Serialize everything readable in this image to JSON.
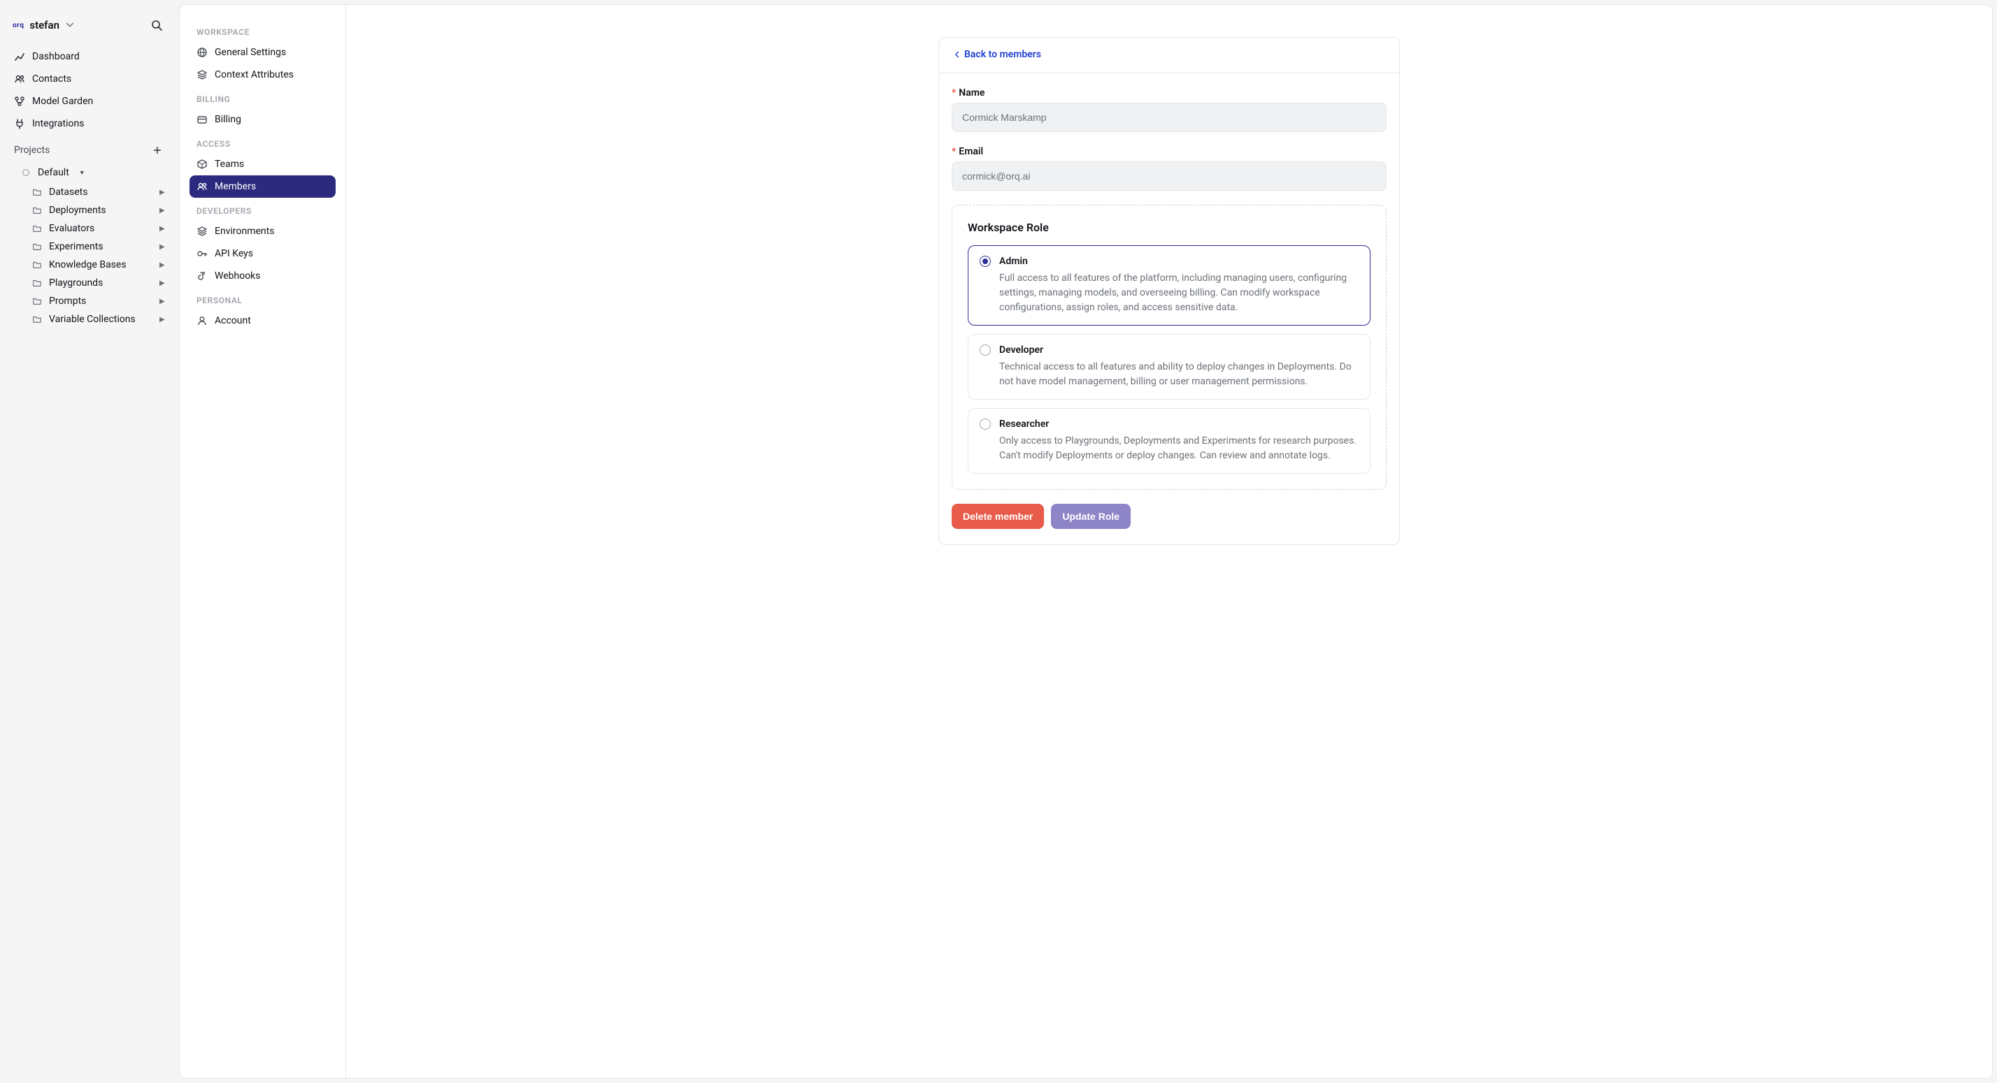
{
  "workspace": {
    "logoText": "orq",
    "name": "stefan"
  },
  "nav": {
    "primary": [
      {
        "id": "dashboard",
        "label": "Dashboard"
      },
      {
        "id": "contacts",
        "label": "Contacts"
      },
      {
        "id": "model-garden",
        "label": "Model Garden"
      },
      {
        "id": "integrations",
        "label": "Integrations"
      }
    ],
    "projectsTitle": "Projects",
    "project": {
      "name": "Default",
      "children": [
        {
          "id": "datasets",
          "label": "Datasets"
        },
        {
          "id": "deployments",
          "label": "Deployments"
        },
        {
          "id": "evaluators",
          "label": "Evaluators"
        },
        {
          "id": "experiments",
          "label": "Experiments"
        },
        {
          "id": "knowledge-bases",
          "label": "Knowledge Bases"
        },
        {
          "id": "playgrounds",
          "label": "Playgrounds"
        },
        {
          "id": "prompts",
          "label": "Prompts"
        },
        {
          "id": "variable-collections",
          "label": "Variable Collections"
        }
      ]
    }
  },
  "settings": {
    "groups": [
      {
        "title": "WORKSPACE",
        "items": [
          {
            "id": "general-settings",
            "label": "General Settings"
          },
          {
            "id": "context-attributes",
            "label": "Context Attributes"
          }
        ]
      },
      {
        "title": "BILLING",
        "items": [
          {
            "id": "billing",
            "label": "Billing"
          }
        ]
      },
      {
        "title": "ACCESS",
        "items": [
          {
            "id": "teams",
            "label": "Teams"
          },
          {
            "id": "members",
            "label": "Members",
            "active": true
          }
        ]
      },
      {
        "title": "DEVELOPERS",
        "items": [
          {
            "id": "environments",
            "label": "Environments"
          },
          {
            "id": "api-keys",
            "label": "API Keys"
          },
          {
            "id": "webhooks",
            "label": "Webhooks"
          }
        ]
      },
      {
        "title": "PERSONAL",
        "items": [
          {
            "id": "account",
            "label": "Account"
          }
        ]
      }
    ]
  },
  "member": {
    "backLabel": "Back to members",
    "nameLabel": "Name",
    "nameValue": "Cormick Marskamp",
    "emailLabel": "Email",
    "emailValue": "cormick@orq.ai",
    "roleTitle": "Workspace Role",
    "roles": [
      {
        "id": "admin",
        "name": "Admin",
        "selected": true,
        "desc": "Full access to all features of the platform, including managing users, configuring settings, managing models, and overseeing billing. Can modify workspace configurations, assign roles, and access sensitive data."
      },
      {
        "id": "developer",
        "name": "Developer",
        "selected": false,
        "desc": "Technical access to all features and ability to deploy changes in Deployments. Do not have model management, billing or user management permissions."
      },
      {
        "id": "researcher",
        "name": "Researcher",
        "selected": false,
        "desc": "Only access to Playgrounds, Deployments and Experiments for research purposes. Can't modify Deployments or deploy changes. Can review and annotate logs."
      }
    ],
    "deleteLabel": "Delete member",
    "updateLabel": "Update Role"
  }
}
